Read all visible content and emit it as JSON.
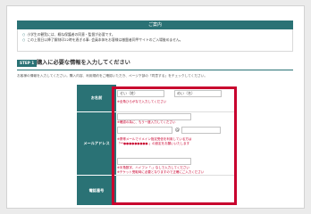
{
  "notice": {
    "title": "ご案内",
    "lines": [
      {
        "mark": "○",
        "text": "小学生の観覧には、概ね保護者の同意・監督が必要です。"
      },
      {
        "mark": "○",
        "text": "この上限日以降了解刻印22時を過ぎる事: 会員本体をお客様は基盤者同甲サイトのご入場後めません。"
      }
    ]
  },
  "step": {
    "badge": "STEP 1",
    "title": "購入に必要な情報を入力してください",
    "description": "お客様の情報を入力してください。購入内容、利用規約をご確認いただき、ページ下部の「同意する」をチェックしてください。"
  },
  "form": {
    "name": {
      "label": "お名前",
      "last_placeholder": "せい（姓）",
      "first_placeholder": "めい（名）",
      "note": "※全角ひらがなで入力してください"
    },
    "email": {
      "label": "メールアドレス",
      "at": "@",
      "confirm_note": "※確認の為に、もう一度入力してください",
      "note1": "※携帯メールでドメイン指定受信を利用している方は",
      "note2": "「**●●●●●●●●●.」の設定をお願いいたします"
    },
    "phone": {
      "label": "電話番号",
      "note1": "※半角数字、ハイフン「-」なしで入力してください",
      "note2": "※チケット受取時に必要となりますので正確にご入力ください"
    }
  },
  "colors": {
    "accent": "#2a7275",
    "highlight": "#c8002e",
    "background": "#ebebeb"
  }
}
